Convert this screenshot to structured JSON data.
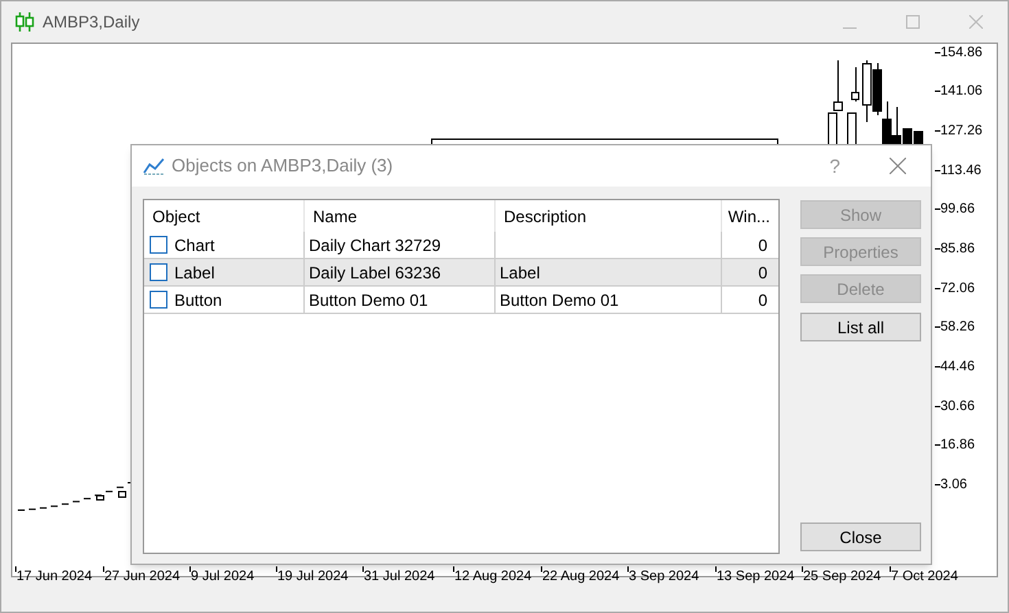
{
  "window": {
    "title": "AMBP3,Daily"
  },
  "chart": {
    "price_axis": [
      "154.86",
      "141.06",
      "127.26",
      "113.46",
      "99.66",
      "85.86",
      "72.06",
      "58.26",
      "44.46",
      "30.66",
      "16.86",
      "3.06"
    ],
    "date_axis": [
      "17 Jun 2024",
      "27 Jun 2024",
      "9 Jul 2024",
      "19 Jul 2024",
      "31 Jul 2024",
      "12 Aug 2024",
      "22 Aug 2024",
      "3 Sep 2024",
      "13 Sep 2024",
      "25 Sep 2024",
      "7 Oct 2024"
    ]
  },
  "dialog": {
    "title": "Objects on AMBP3,Daily (3)",
    "help": "?",
    "columns": [
      "Object",
      "Name",
      "Description",
      "Win..."
    ],
    "rows": [
      {
        "object": "Chart",
        "name": "Daily Chart 32729",
        "description": "",
        "window": "0",
        "checked": false,
        "selected": false
      },
      {
        "object": "Label",
        "name": "Daily Label 63236",
        "description": "Label",
        "window": "0",
        "checked": false,
        "selected": true
      },
      {
        "object": "Button",
        "name": "Button Demo 01",
        "description": "Button Demo 01",
        "window": "0",
        "checked": false,
        "selected": false
      }
    ],
    "buttons": [
      {
        "label": "Show",
        "disabled": true
      },
      {
        "label": "Properties",
        "disabled": true
      },
      {
        "label": "Delete",
        "disabled": true
      },
      {
        "label": "List all",
        "disabled": false
      }
    ],
    "close_button": {
      "label": "Close",
      "disabled": false
    }
  }
}
